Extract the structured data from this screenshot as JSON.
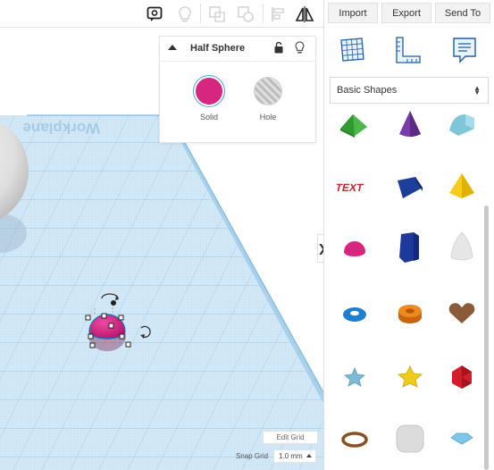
{
  "toolbar": {
    "icons": [
      "note-icon",
      "bulb-icon",
      "shape-group-icon",
      "duplicate-icon",
      "align-icon",
      "mirror-icon"
    ]
  },
  "header_buttons": {
    "import": "Import",
    "export": "Export",
    "send_to": "Send To"
  },
  "panel_icons": [
    "workplane-grid-icon",
    "ruler-icon",
    "notes-icon"
  ],
  "inspector": {
    "title": "Half Sphere",
    "solid_label": "Solid",
    "hole_label": "Hole",
    "solid_color": "#d7267f"
  },
  "workplane_label": "Workplane",
  "shapes_panel": {
    "category": "Basic Shapes",
    "shapes": [
      "Roof",
      "Cone",
      "Round Roof",
      "Text",
      "Polygon Box",
      "Pyramid",
      "Half Sphere",
      "Polygon",
      "Paraboloid",
      "Torus",
      "Tube",
      "Heart",
      "Star",
      "Star 2",
      "Icosahedron",
      "Ring",
      "Rounded Box",
      "Gem"
    ]
  },
  "edit_grid": "Edit Grid",
  "snap_grid": {
    "label": "Snap Grid",
    "value": "1.0 mm"
  },
  "colors": {
    "accent_blue": "#4da3e6",
    "workplane": "#cfe6f5",
    "grid_line": "#a9d0ea"
  }
}
